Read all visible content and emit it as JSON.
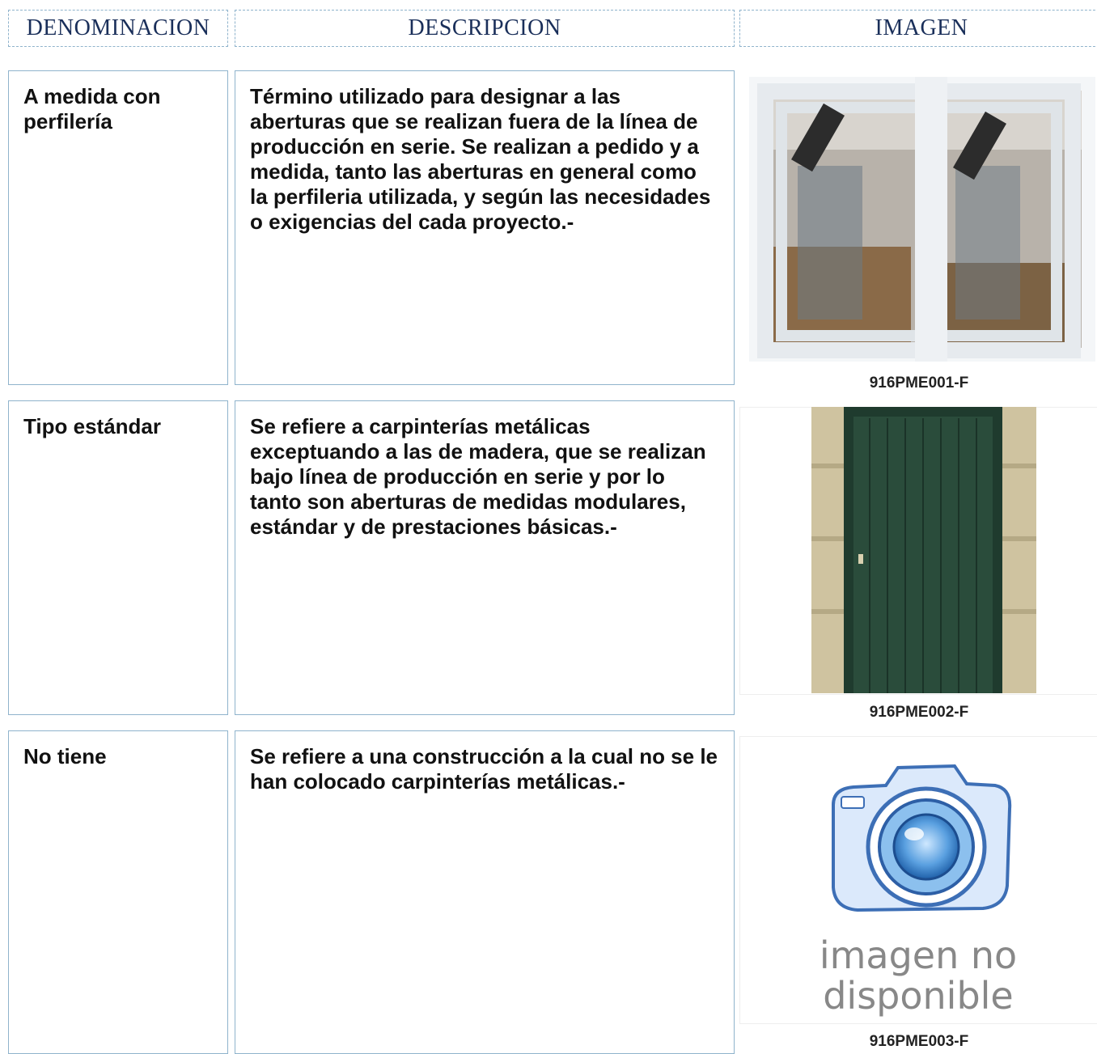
{
  "headers": {
    "denominacion": "DENOMINACION",
    "descripcion": "DESCRIPCION",
    "imagen": "IMAGEN"
  },
  "rows": [
    {
      "denominacion": "A medida con perfilería",
      "descripcion": "Término utilizado para designar a las aberturas que se realizan fuera de la línea de producción en serie. Se realizan a pedido y a medida, tanto las aberturas en general como la perfileria utilizada, y según las necesidades o exigencias del cada proyecto.-",
      "image_code": "916PME001-F"
    },
    {
      "denominacion": "Tipo estándar",
      "descripcion": "Se refiere a carpinterías metálicas exceptuando a las de madera, que se realizan bajo línea de producción en serie y por lo tanto son aberturas de medidas modulares, estándar y de prestaciones básicas.-",
      "image_code": "916PME002-F"
    },
    {
      "denominacion": "No tiene",
      "descripcion": "Se refiere a una construcción a la cual no se le han colocado carpinterías metálicas.-",
      "image_code": "916PME003-F",
      "placeholder_line1": "imagen no",
      "placeholder_line2": "disponible"
    }
  ]
}
